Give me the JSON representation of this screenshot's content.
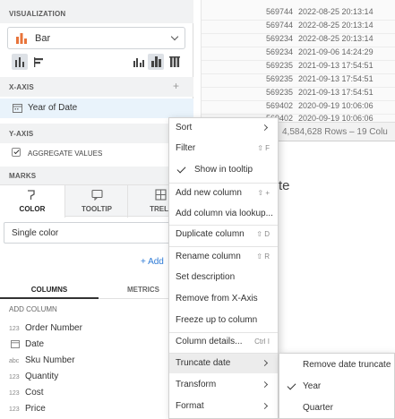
{
  "left_panel": {
    "visualization_label": "VISUALIZATION",
    "chart_type": "Bar",
    "xaxis_label": "X-AXIS",
    "xaxis_field": "Year of Date",
    "yaxis_label": "Y-AXIS",
    "aggregate_values": "AGGREGATE VALUES",
    "marks_label": "MARKS",
    "tabs": {
      "color": "COLOR",
      "tooltip": "TOOLTIP",
      "trellis": "TRELL"
    },
    "single_color": "Single color",
    "add_label": "+ Add",
    "panel_tabs": {
      "columns": "COLUMNS",
      "metrics": "METRICS"
    },
    "add_column": "ADD COLUMN",
    "columns": [
      {
        "type": "123",
        "name": "Order Number"
      },
      {
        "type": "cal",
        "name": "Date"
      },
      {
        "type": "abc",
        "name": "Sku Number"
      },
      {
        "type": "123",
        "name": "Quantity"
      },
      {
        "type": "123",
        "name": "Cost"
      },
      {
        "type": "123",
        "name": "Price"
      }
    ]
  },
  "table": {
    "rows": [
      {
        "id": "569744",
        "ts": "2022-08-25 20:13:14"
      },
      {
        "id": "569744",
        "ts": "2022-08-25 20:13:14"
      },
      {
        "id": "569234",
        "ts": "2022-08-25 20:13:14"
      },
      {
        "id": "569234",
        "ts": "2021-09-06 14:24:29"
      },
      {
        "id": "569235",
        "ts": "2021-09-13 17:54:51"
      },
      {
        "id": "569235",
        "ts": "2021-09-13 17:54:51"
      },
      {
        "id": "569235",
        "ts": "2021-09-13 17:54:51"
      },
      {
        "id": "569402",
        "ts": "2020-09-19 10:06:06"
      },
      {
        "id": "569402",
        "ts": "2020-09-19 10:06:06"
      }
    ],
    "footer": "4,584,628 Rows – 19 Colu",
    "bg_title": "te"
  },
  "context_menu": {
    "sort": "Sort",
    "filter": "Filter",
    "filter_sc": "⇧ F",
    "show_tooltip": "Show in tooltip",
    "add_new_column": "Add new column",
    "add_new_column_sc": "⇧ +",
    "add_column_lookup": "Add column via lookup...",
    "duplicate_column": "Duplicate column",
    "duplicate_column_sc": "⇧ D",
    "rename_column": "Rename column",
    "rename_column_sc": "⇧ R",
    "set_description": "Set description",
    "remove_from_xaxis": "Remove from X-Axis",
    "freeze_column": "Freeze up to column",
    "column_details": "Column details...",
    "column_details_sc": "Ctrl I",
    "truncate_date": "Truncate date",
    "transform": "Transform",
    "format": "Format"
  },
  "submenu": {
    "remove_truncate": "Remove date truncate",
    "year": "Year",
    "quarter": "Quarter"
  },
  "colors": {
    "bar_icon_accent": "#e8743b",
    "highlight_row": "#e9f3fb",
    "menu_hover": "#ececec"
  }
}
